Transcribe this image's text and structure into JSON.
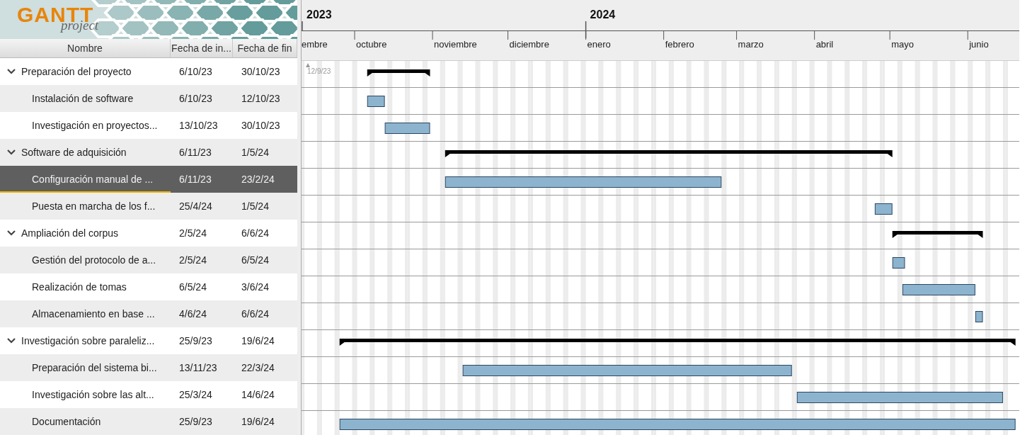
{
  "logo": {
    "title": "GANTT",
    "subtitle": "project"
  },
  "columns": [
    "Nombre",
    "Fecha de in...",
    "Fecha de fin"
  ],
  "timeline": {
    "years": [
      "2023",
      "2024"
    ],
    "months": [
      "embre",
      "octubre",
      "noviembre",
      "diciembre",
      "enero",
      "febrero",
      "marzo",
      "abril",
      "mayo",
      "junio"
    ],
    "start_marker": "12/9/23"
  },
  "tasks": [
    {
      "name": "Preparación del proyecto",
      "start": "6/10/23",
      "end": "30/10/23",
      "expanded": true,
      "selected": false,
      "children": [
        {
          "name": "Instalación de software",
          "start": "6/10/23",
          "end": "12/10/23",
          "selected": false
        },
        {
          "name": "Investigación en proyectos...",
          "start": "13/10/23",
          "end": "30/10/23",
          "selected": false
        }
      ]
    },
    {
      "name": "Software de adquisición",
      "start": "6/11/23",
      "end": "1/5/24",
      "expanded": true,
      "selected": false,
      "children": [
        {
          "name": "Configuración manual de ...",
          "start": "6/11/23",
          "end": "23/2/24",
          "selected": true
        },
        {
          "name": "Puesta en marcha de los f...",
          "start": "25/4/24",
          "end": "1/5/24",
          "selected": false
        }
      ]
    },
    {
      "name": "Ampliación del corpus",
      "start": "2/5/24",
      "end": "6/6/24",
      "expanded": true,
      "selected": false,
      "children": [
        {
          "name": "Gestión del protocolo de a...",
          "start": "2/5/24",
          "end": "6/5/24",
          "selected": false
        },
        {
          "name": "Realización de tomas",
          "start": "6/5/24",
          "end": "3/6/24",
          "selected": false
        },
        {
          "name": "Almacenamiento en base ...",
          "start": "4/6/24",
          "end": "6/6/24",
          "selected": false
        }
      ]
    },
    {
      "name": "Investigación sobre paraleliz...",
      "start": "25/9/23",
      "end": "19/6/24",
      "expanded": true,
      "selected": false,
      "children": [
        {
          "name": "Preparación del sistema bi...",
          "start": "13/11/23",
          "end": "22/3/24",
          "selected": false
        },
        {
          "name": "Investigación sobre las alt...",
          "start": "25/3/24",
          "end": "14/6/24",
          "selected": false
        },
        {
          "name": "Documentación",
          "start": "25/9/23",
          "end": "19/6/24",
          "selected": false
        }
      ]
    }
  ]
}
